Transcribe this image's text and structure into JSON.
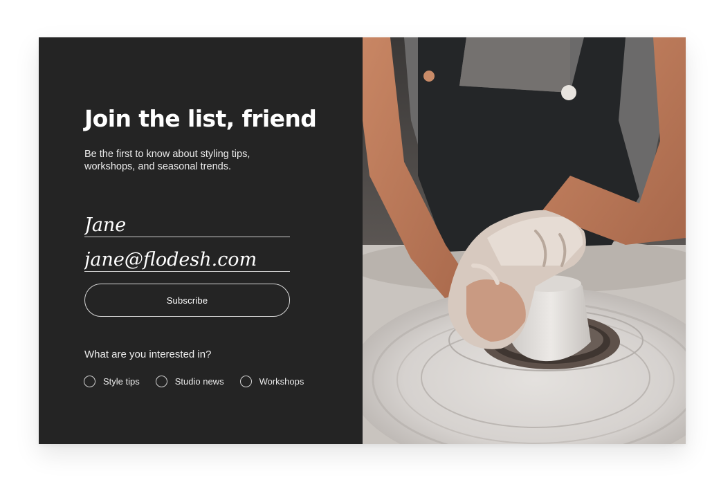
{
  "signup": {
    "title": "Join the list, friend",
    "subtitle": "Be the first to know about styling tips, workshops, and seasonal trends.",
    "name_value": "Jane",
    "email_value": "jane@flodesh.com",
    "subscribe_label": "Subscribe",
    "interests_question": "What are you interested in?",
    "options": [
      {
        "label": "Style tips",
        "checked": false
      },
      {
        "label": "Studio news",
        "checked": false
      },
      {
        "label": "Workshops",
        "checked": false
      }
    ]
  },
  "colors": {
    "panel": "#242424",
    "text": "#ffffff",
    "line": "#cfcfcf"
  },
  "photo": {
    "subject": "hands shaping clay on a pottery wheel"
  }
}
